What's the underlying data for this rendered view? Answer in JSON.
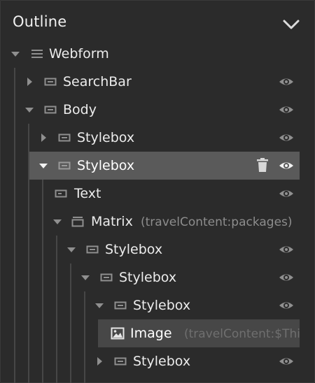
{
  "header": {
    "title": "Outline"
  },
  "tree": [
    {
      "label": "Webform",
      "hint": ""
    },
    {
      "label": "SearchBar",
      "hint": ""
    },
    {
      "label": "Body",
      "hint": ""
    },
    {
      "label": "Stylebox",
      "hint": ""
    },
    {
      "label": "Stylebox",
      "hint": ""
    },
    {
      "label": "Text",
      "hint": ""
    },
    {
      "label": "Matrix",
      "hint": "(travelContent:packages)"
    },
    {
      "label": "Stylebox",
      "hint": ""
    },
    {
      "label": "Stylebox",
      "hint": ""
    },
    {
      "label": "Stylebox",
      "hint": ""
    },
    {
      "label": "Image",
      "hint": "(travelContent:$Thi"
    },
    {
      "label": "Stylebox",
      "hint": ""
    }
  ],
  "colors": {
    "background": "#2b2b2b",
    "selected_row": "#5a5a5a",
    "image_row": "#474747",
    "text": "#ececec",
    "hint": "#8d8d8d",
    "icon": "#8f8f8f"
  }
}
